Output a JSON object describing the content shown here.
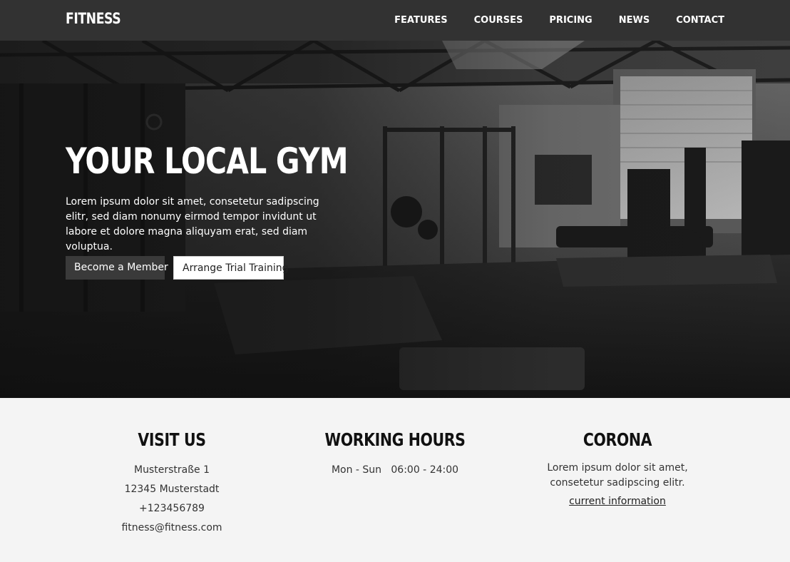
{
  "header": {
    "logo": "FITNESS",
    "nav": [
      {
        "label": "FEATURES"
      },
      {
        "label": "COURSES"
      },
      {
        "label": "PRICING"
      },
      {
        "label": "NEWS"
      },
      {
        "label": "CONTACT"
      }
    ]
  },
  "hero": {
    "title": "YOUR LOCAL GYM",
    "text": "Lorem ipsum dolor sit amet, consetetur sadipscing elitr, sed diam nonumy eirmod tempor invidunt ut labore et dolore magna aliquyam erat, sed diam voluptua.",
    "primary_button": "Become a Member",
    "secondary_button": "Arrange Trial Training"
  },
  "info": {
    "visit": {
      "heading": "VISIT US",
      "lines": [
        "Musterstraße 1",
        "12345 Musterstadt",
        "+123456789",
        "fitness@fitness.com"
      ]
    },
    "hours": {
      "heading": "WORKING HOURS",
      "line": "Mon - Sun   06:00 - 24:00"
    },
    "corona": {
      "heading": "CORONA",
      "text": "Lorem ipsum dolor sit amet, consetetur sadipscing elitr.",
      "link": "current information"
    }
  },
  "colors": {
    "navbar": "#323232",
    "info_background": "#f4f4f4",
    "primary_button": "#3a3a3a",
    "secondary_button": "#ffffff"
  }
}
